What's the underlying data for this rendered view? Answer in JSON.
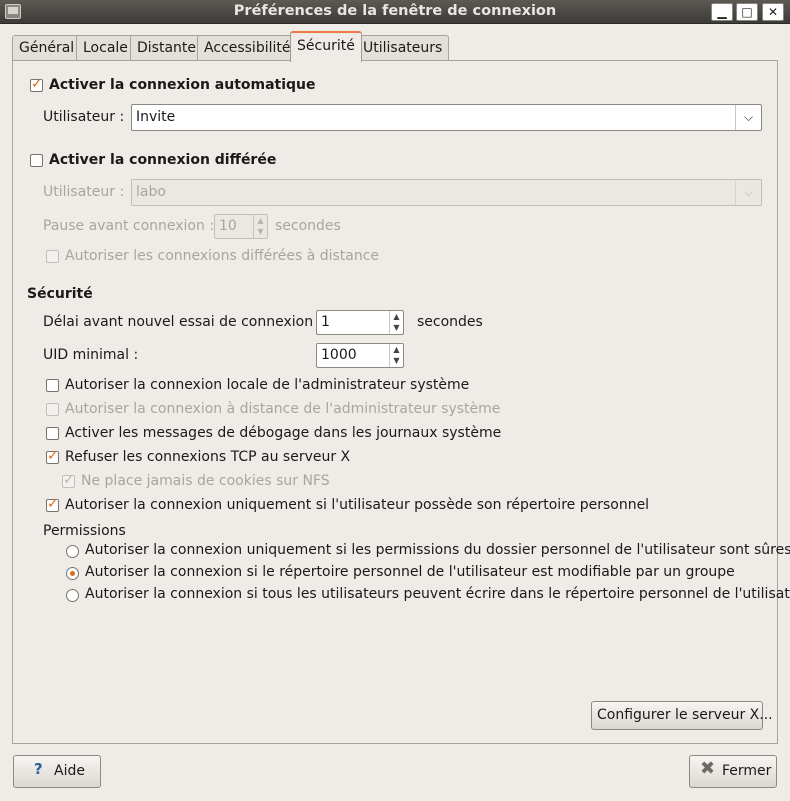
{
  "window": {
    "title": "Préférences de la fenêtre de connexion",
    "controls": {
      "minimize": "▁",
      "maximize": "□",
      "close": "✕"
    }
  },
  "tabs": [
    "Général",
    "Locale",
    "Distante",
    "Accessibilité",
    "Sécurité",
    "Utilisateurs"
  ],
  "active_tab": "Sécurité",
  "autologin": {
    "label": "Activer la connexion automatique",
    "checked": true,
    "user_label": "Utilisateur :",
    "user_value": "Invite"
  },
  "timed_login": {
    "label": "Activer la connexion différée",
    "checked": false,
    "user_label": "Utilisateur :",
    "user_value": "labo",
    "pause_label": "Pause avant connexion :",
    "pause_value": "10",
    "pause_unit": "secondes",
    "remote_label": "Autoriser les connexions différées à distance"
  },
  "security": {
    "heading": "Sécurité",
    "retry_label": "Délai avant nouvel essai de connexion :",
    "retry_value": "1",
    "retry_unit": "secondes",
    "uid_label": "UID minimal :",
    "uid_value": "1000",
    "options": [
      {
        "label": "Autoriser la connexion locale de l'administrateur système",
        "checked": false,
        "enabled": true
      },
      {
        "label": "Autoriser la connexion à distance de l'administrateur système",
        "checked": false,
        "enabled": false
      },
      {
        "label": "Activer les messages de débogage dans les journaux système",
        "checked": false,
        "enabled": true
      },
      {
        "label": "Refuser les connexions TCP au serveur X",
        "checked": true,
        "enabled": true
      },
      {
        "label": "Ne place jamais de cookies sur NFS",
        "checked": true,
        "enabled": false
      },
      {
        "label": "Autoriser la connexion uniquement si l'utilisateur possède son répertoire personnel",
        "checked": true,
        "enabled": true
      }
    ],
    "permissions_heading": "Permissions",
    "permissions": [
      {
        "label": "Autoriser la connexion uniquement si les permissions du dossier personnel de l'utilisateur sont sûres",
        "selected": false
      },
      {
        "label": "Autoriser la connexion si le répertoire personnel de l'utilisateur est modifiable par un groupe",
        "selected": true
      },
      {
        "label": "Autoriser la connexion si tous les utilisateurs peuvent écrire dans le répertoire personnel de l'utilisateur",
        "selected": false
      }
    ],
    "configure_button": "Configurer le serveur X..."
  },
  "footer": {
    "help": "Aide",
    "close": "Fermer"
  },
  "colors": {
    "accent": "#d86f1e",
    "tab_highlight": "#f07746",
    "background": "#efebe7",
    "titlebar": "#3c3b37"
  }
}
